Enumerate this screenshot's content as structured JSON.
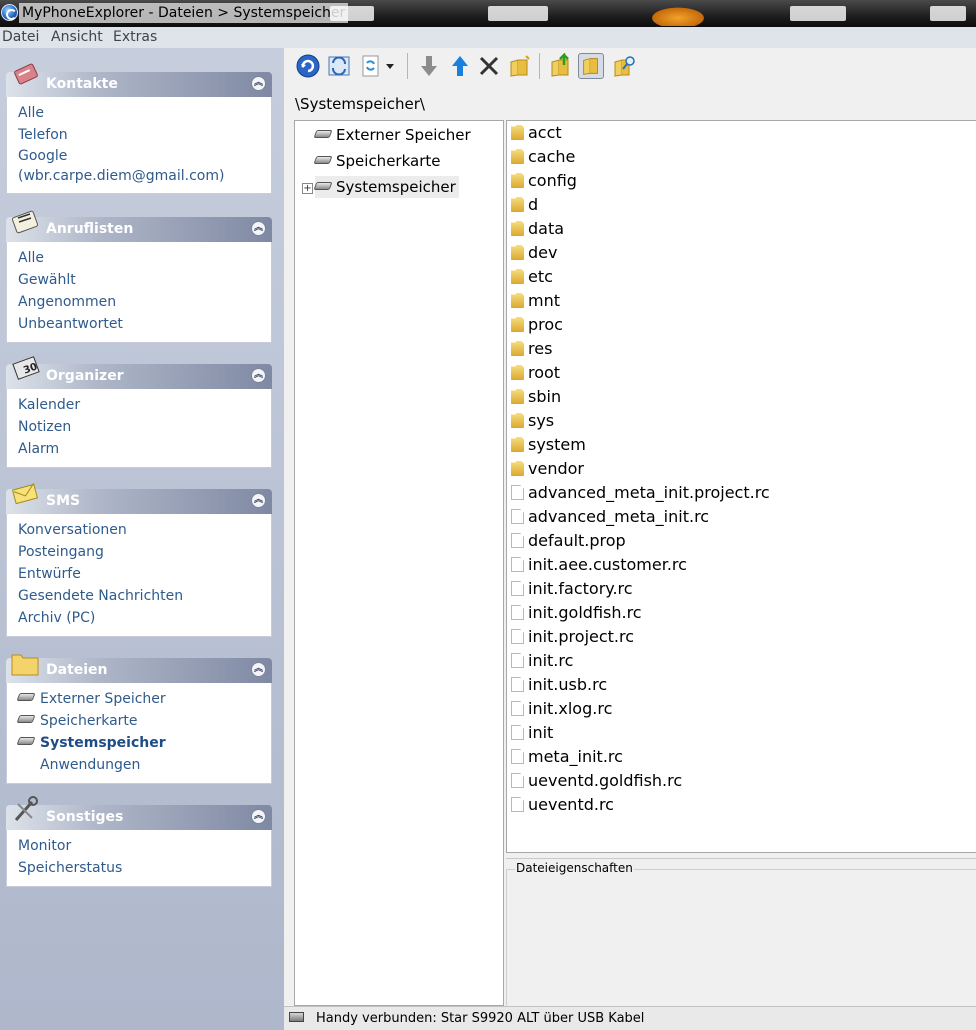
{
  "window": {
    "title": "MyPhoneExplorer -  Dateien > Systemspeicher"
  },
  "menu": [
    "Datei",
    "Ansicht",
    "Extras"
  ],
  "sidebar": {
    "panels": [
      {
        "title": "Kontakte",
        "icon": "contacts-icon",
        "items": [
          "Alle",
          "Telefon",
          "Google",
          "(wbr.carpe.diem@gmail.com)"
        ]
      },
      {
        "title": "Anruflisten",
        "icon": "calllist-icon",
        "items": [
          "Alle",
          "Gewählt",
          "Angenommen",
          "Unbeantwortet"
        ]
      },
      {
        "title": "Organizer",
        "icon": "calendar-icon",
        "items": [
          "Kalender",
          "Notizen",
          "Alarm"
        ]
      },
      {
        "title": "SMS",
        "icon": "envelope-icon",
        "items": [
          "Konversationen",
          "Posteingang",
          "Entwürfe",
          "Gesendete Nachrichten",
          "Archiv (PC)"
        ]
      },
      {
        "title": "Dateien",
        "icon": "folder-icon",
        "items": [
          "Externer Speicher",
          "Speicherkarte",
          "Systemspeicher",
          "Anwendungen"
        ]
      },
      {
        "title": "Sonstiges",
        "icon": "tools-icon",
        "items": [
          "Monitor",
          "Speicherstatus"
        ]
      }
    ]
  },
  "address": "\\Systemspeicher\\",
  "tree": [
    "Externer Speicher",
    "Speicherkarte",
    "Systemspeicher"
  ],
  "files": [
    {
      "name": "acct",
      "type": "folder"
    },
    {
      "name": "cache",
      "type": "folder"
    },
    {
      "name": "config",
      "type": "folder"
    },
    {
      "name": "d",
      "type": "folder"
    },
    {
      "name": "data",
      "type": "folder"
    },
    {
      "name": "dev",
      "type": "folder"
    },
    {
      "name": "etc",
      "type": "folder"
    },
    {
      "name": "mnt",
      "type": "folder"
    },
    {
      "name": "proc",
      "type": "folder"
    },
    {
      "name": "res",
      "type": "folder"
    },
    {
      "name": "root",
      "type": "folder"
    },
    {
      "name": "sbin",
      "type": "folder"
    },
    {
      "name": "sys",
      "type": "folder"
    },
    {
      "name": "system",
      "type": "folder"
    },
    {
      "name": "vendor",
      "type": "folder"
    },
    {
      "name": "advanced_meta_init.project.rc",
      "type": "file"
    },
    {
      "name": "advanced_meta_init.rc",
      "type": "file"
    },
    {
      "name": "default.prop",
      "type": "file"
    },
    {
      "name": "init.aee.customer.rc",
      "type": "file"
    },
    {
      "name": "init.factory.rc",
      "type": "file"
    },
    {
      "name": "init.goldfish.rc",
      "type": "file"
    },
    {
      "name": "init.project.rc",
      "type": "file"
    },
    {
      "name": "init.rc",
      "type": "file"
    },
    {
      "name": "init.usb.rc",
      "type": "file"
    },
    {
      "name": "init.xlog.rc",
      "type": "file"
    },
    {
      "name": "init",
      "type": "file"
    },
    {
      "name": "meta_init.rc",
      "type": "file"
    },
    {
      "name": "ueventd.goldfish.rc",
      "type": "file"
    },
    {
      "name": "ueventd.rc",
      "type": "file"
    }
  ],
  "properties_label": "Dateieigenschaften",
  "status": "Handy verbunden: Star S9920 ALT über USB Kabel",
  "colors": {
    "link": "#2f5b8c",
    "panel_header": "#7f89a3",
    "sidebar_bg": "#c6cedd"
  }
}
